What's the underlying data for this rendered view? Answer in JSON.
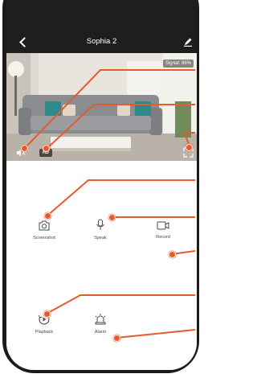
{
  "header": {
    "title": "Sophia 2"
  },
  "video": {
    "signal_text": "Signal: 86%",
    "hd_label": "HD"
  },
  "controls": [
    {
      "label": "Screenshot",
      "icon": "camera-icon"
    },
    {
      "label": "Speak",
      "icon": "microphone-icon"
    },
    {
      "label": "Record",
      "icon": "video-camera-icon"
    },
    {
      "label": "Playback",
      "icon": "playback-icon"
    },
    {
      "label": "Alarm",
      "icon": "alarm-light-icon"
    }
  ],
  "colors": {
    "header_bg": "#1e1e1e",
    "accent": "#e55b2c",
    "frame": "#1b1b1b",
    "icon": "#4a4a4a"
  }
}
